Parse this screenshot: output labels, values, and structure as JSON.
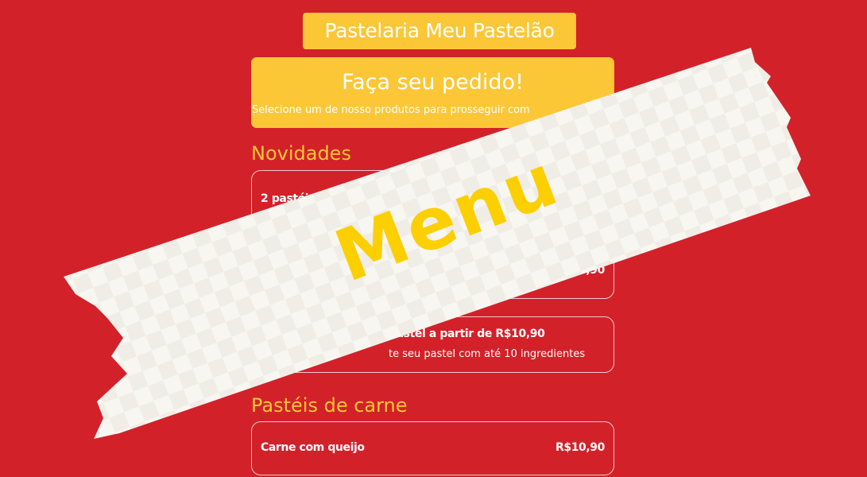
{
  "shop": {
    "title": "Pastelaria Meu Pastelão"
  },
  "order_banner": {
    "heading": "Faça seu pedido!",
    "subtitle": "Selecione um de nosso produtos para prosseguir com"
  },
  "sections": [
    {
      "title": "Novidades",
      "items": [
        {
          "name": "2 pastéi",
          "price": ",90",
          "description": ""
        },
        {
          "name": "pastel a partir de R$10,90",
          "price": "",
          "description": "te seu pastel com até 10 ingredientes"
        }
      ]
    },
    {
      "title": "Pastéis de carne",
      "items": [
        {
          "name": "Carne com queijo",
          "price": "R$10,90",
          "description": ""
        }
      ]
    }
  ],
  "overlay": {
    "label": "Menu"
  },
  "colors": {
    "background": "#d3212a",
    "accent_yellow": "#fcc736",
    "tape": "#f7f5f0",
    "menu_text": "#fccf00"
  }
}
